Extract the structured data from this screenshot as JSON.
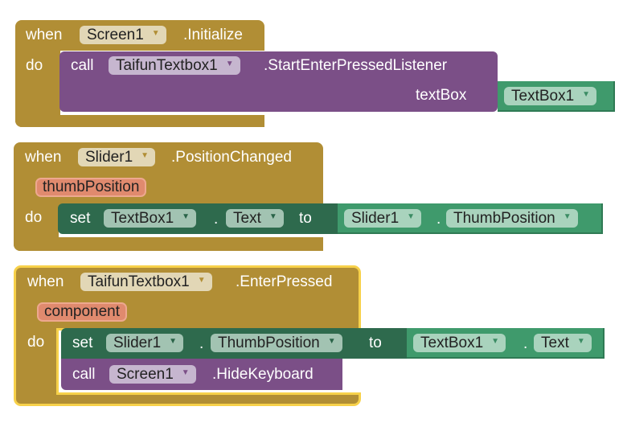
{
  "blocks": [
    {
      "event": "when",
      "component": "Screen1",
      "handler": ".Initialize",
      "do_label": "do",
      "statement": {
        "keyword": "call",
        "component": "TaifunTextbox1",
        "method": ".StartEnterPressedListener",
        "arg_label": "textBox",
        "arg_value": "TextBox1"
      }
    },
    {
      "event": "when",
      "component": "Slider1",
      "handler": ".PositionChanged",
      "param": "thumbPosition",
      "do_label": "do",
      "statement": {
        "keyword": "set",
        "component": "TextBox1",
        "dot": ".",
        "property": "Text",
        "to_label": "to",
        "value_component": "Slider1",
        "value_property": "ThumbPosition"
      }
    },
    {
      "event": "when",
      "component": "TaifunTextbox1",
      "handler": ".EnterPressed",
      "param": "component",
      "do_label": "do",
      "selected": true,
      "statement": {
        "keyword": "set",
        "component": "Slider1",
        "dot": ".",
        "property": "ThumbPosition",
        "to_label": "to",
        "value_component": "TextBox1",
        "value_property": "Text"
      },
      "statement2": {
        "keyword": "call",
        "component": "Screen1",
        "method": ".HideKeyboard"
      }
    }
  ],
  "icons": {
    "dropdown": "▼"
  },
  "colors": {
    "event": "#b18e35",
    "procedure": "#7b4f87",
    "setter": "#2e6a4d",
    "getter": "#3f9a6c",
    "param": "#e08a6e",
    "selection": "#f7d14a"
  }
}
